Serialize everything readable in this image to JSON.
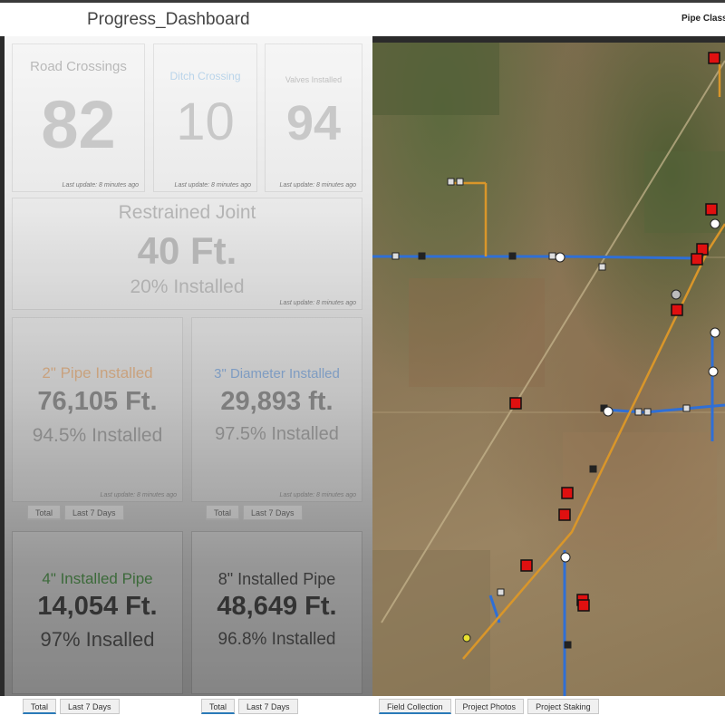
{
  "header": {
    "title": "Progress_Dashboard",
    "right_label": "Pipe Class"
  },
  "update_text": "Last update: 8 minutes ago",
  "stats": {
    "road_crossings": {
      "title": "Road Crossings",
      "value": "82"
    },
    "ditch_crossing": {
      "title": "Ditch Crossing",
      "value": "10"
    },
    "valves_installed": {
      "title": "Valves Installed",
      "value": "94"
    },
    "restrained_joint": {
      "title": "Restrained Joint",
      "value": "40 Ft.",
      "sub": "20% Installed"
    },
    "pipe2": {
      "title": "2\" Pipe Installed",
      "value": "76,105 Ft.",
      "sub": "94.5% Installed"
    },
    "pipe3": {
      "title": "3\" Diameter Installed",
      "value": "29,893 ft.",
      "sub": "97.5% Installed"
    },
    "pipe4": {
      "title": "4\" Installed Pipe",
      "value": "14,054 Ft.",
      "sub": "97% Insalled"
    },
    "pipe8": {
      "title": "8\" Installed Pipe",
      "value": "48,649 Ft.",
      "sub": "96.8% Installed"
    }
  },
  "tabs": {
    "total": "Total",
    "last7": "Last 7 Days"
  },
  "map_tabs": {
    "field": "Field Collection",
    "photos": "Project Photos",
    "staking": "Project Staking"
  },
  "colors": {
    "blue_line": "#2f6fd6",
    "orange_line": "#d9962a",
    "marker_red": "#e01010",
    "active_tab": "#2a7ab8"
  }
}
